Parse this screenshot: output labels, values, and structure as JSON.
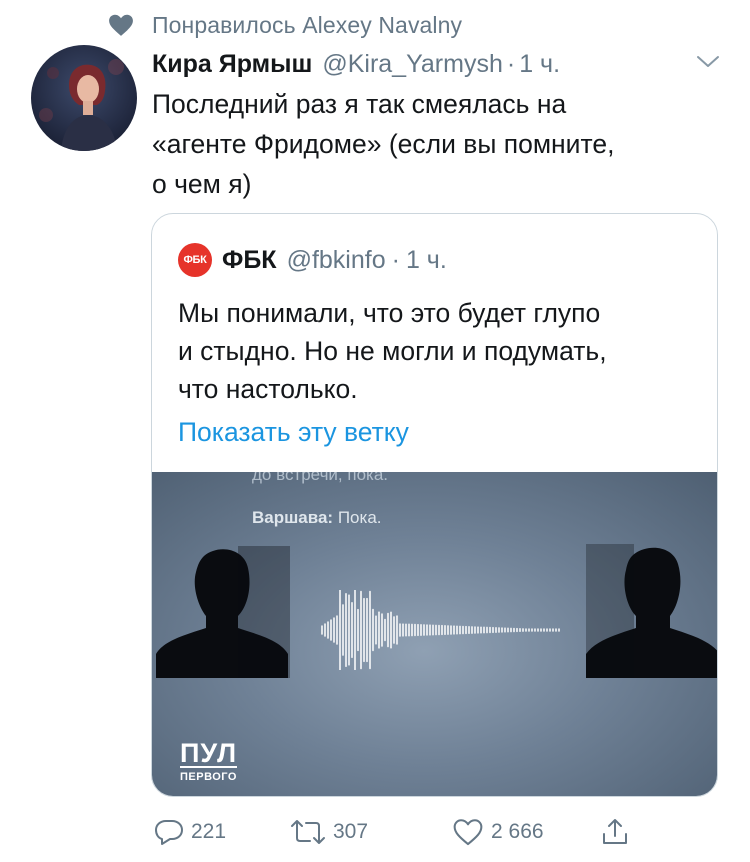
{
  "social_context": {
    "icon": "heart-icon",
    "text": "Понравилось Alexey Navalny"
  },
  "tweet": {
    "author_name": "Кира Ярмыш",
    "author_handle": "@Kira_Yarmysh",
    "separator": "·",
    "time": "1 ч.",
    "text_lines": [
      "Последний раз я так смеялась на",
      "«агенте Фридоме» (если вы помните,",
      "о чем я)"
    ]
  },
  "quote": {
    "logo_text": "ФБК",
    "name": "ФБК",
    "handle": "@fbkinfo",
    "separator": "·",
    "time": "1 ч.",
    "text_lines": [
      "Мы понимали, что это будет глупо",
      "и стыдно. Но не могли и подумать,",
      "что настолько."
    ],
    "show_thread": "Показать эту ветку",
    "media": {
      "caption_top": "до встречи, пока.",
      "speaker": "Варшава:",
      "speech": "Пока.",
      "logo_big": "ПУЛ",
      "logo_small": "ПЕРВОГО"
    }
  },
  "actions": {
    "replies": "221",
    "retweets": "307",
    "likes": "2 666"
  },
  "colors": {
    "link": "#1b95e0",
    "secondary": "#657786",
    "fbk_red": "#e6332a"
  }
}
